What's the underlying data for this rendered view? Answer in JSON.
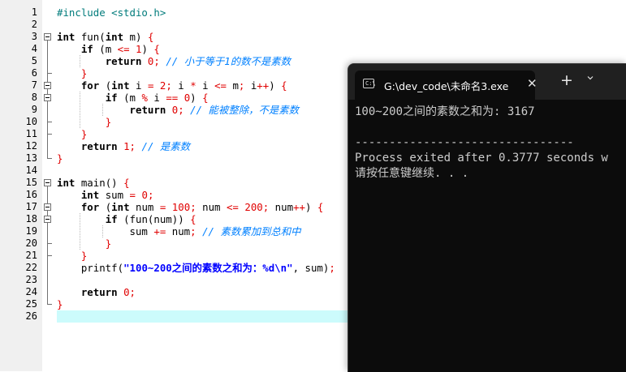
{
  "editor": {
    "current_line": 26,
    "lines": [
      {
        "n": "1",
        "tokens": [
          [
            "pp",
            "#include <stdio.h>"
          ]
        ]
      },
      {
        "n": "2",
        "tokens": []
      },
      {
        "n": "3",
        "tokens": [
          [
            "kw",
            "int"
          ],
          [
            "t",
            " fun("
          ],
          [
            "kw",
            "int"
          ],
          [
            "t",
            " m) "
          ],
          [
            "op",
            "{"
          ]
        ]
      },
      {
        "n": "4",
        "tokens": [
          [
            "t",
            "    "
          ],
          [
            "kw",
            "if"
          ],
          [
            "t",
            " ("
          ],
          [
            "t",
            "m "
          ],
          [
            "op",
            "<="
          ],
          [
            "t",
            " "
          ],
          [
            "num",
            "1"
          ],
          [
            "t",
            ") "
          ],
          [
            "op",
            "{"
          ]
        ]
      },
      {
        "n": "5",
        "tokens": [
          [
            "t",
            "        "
          ],
          [
            "kw",
            "return"
          ],
          [
            "t",
            " "
          ],
          [
            "num",
            "0"
          ],
          [
            "op",
            ";"
          ],
          [
            "t",
            " "
          ],
          [
            "cmt",
            "// 小于等于1的数不是素数"
          ]
        ]
      },
      {
        "n": "6",
        "tokens": [
          [
            "t",
            "    "
          ],
          [
            "op",
            "}"
          ]
        ]
      },
      {
        "n": "7",
        "tokens": [
          [
            "t",
            "    "
          ],
          [
            "kw",
            "for"
          ],
          [
            "t",
            " ("
          ],
          [
            "kw",
            "int"
          ],
          [
            "t",
            " i "
          ],
          [
            "op",
            "="
          ],
          [
            "t",
            " "
          ],
          [
            "num",
            "2"
          ],
          [
            "op",
            ";"
          ],
          [
            "t",
            " i "
          ],
          [
            "op",
            "*"
          ],
          [
            "t",
            " i "
          ],
          [
            "op",
            "<="
          ],
          [
            "t",
            " m"
          ],
          [
            "op",
            ";"
          ],
          [
            "t",
            " i"
          ],
          [
            "op",
            "++"
          ],
          [
            "t",
            ") "
          ],
          [
            "op",
            "{"
          ]
        ]
      },
      {
        "n": "8",
        "tokens": [
          [
            "t",
            "        "
          ],
          [
            "kw",
            "if"
          ],
          [
            "t",
            " (m "
          ],
          [
            "op",
            "%"
          ],
          [
            "t",
            " i "
          ],
          [
            "op",
            "=="
          ],
          [
            "t",
            " "
          ],
          [
            "num",
            "0"
          ],
          [
            "t",
            ") "
          ],
          [
            "op",
            "{"
          ]
        ]
      },
      {
        "n": "9",
        "tokens": [
          [
            "t",
            "            "
          ],
          [
            "kw",
            "return"
          ],
          [
            "t",
            " "
          ],
          [
            "num",
            "0"
          ],
          [
            "op",
            ";"
          ],
          [
            "t",
            " "
          ],
          [
            "cmt",
            "// 能被整除，不是素数"
          ]
        ]
      },
      {
        "n": "10",
        "tokens": [
          [
            "t",
            "        "
          ],
          [
            "op",
            "}"
          ]
        ]
      },
      {
        "n": "11",
        "tokens": [
          [
            "t",
            "    "
          ],
          [
            "op",
            "}"
          ]
        ]
      },
      {
        "n": "12",
        "tokens": [
          [
            "t",
            "    "
          ],
          [
            "kw",
            "return"
          ],
          [
            "t",
            " "
          ],
          [
            "num",
            "1"
          ],
          [
            "op",
            ";"
          ],
          [
            "t",
            " "
          ],
          [
            "cmt",
            "// 是素数"
          ]
        ]
      },
      {
        "n": "13",
        "tokens": [
          [
            "op",
            "}"
          ]
        ]
      },
      {
        "n": "14",
        "tokens": []
      },
      {
        "n": "15",
        "tokens": [
          [
            "kw",
            "int"
          ],
          [
            "t",
            " main() "
          ],
          [
            "op",
            "{"
          ]
        ]
      },
      {
        "n": "16",
        "tokens": [
          [
            "t",
            "    "
          ],
          [
            "kw",
            "int"
          ],
          [
            "t",
            " sum "
          ],
          [
            "op",
            "="
          ],
          [
            "t",
            " "
          ],
          [
            "num",
            "0"
          ],
          [
            "op",
            ";"
          ]
        ]
      },
      {
        "n": "17",
        "tokens": [
          [
            "t",
            "    "
          ],
          [
            "kw",
            "for"
          ],
          [
            "t",
            " ("
          ],
          [
            "kw",
            "int"
          ],
          [
            "t",
            " num "
          ],
          [
            "op",
            "="
          ],
          [
            "t",
            " "
          ],
          [
            "num",
            "100"
          ],
          [
            "op",
            ";"
          ],
          [
            "t",
            " num "
          ],
          [
            "op",
            "<="
          ],
          [
            "t",
            " "
          ],
          [
            "num",
            "200"
          ],
          [
            "op",
            ";"
          ],
          [
            "t",
            " num"
          ],
          [
            "op",
            "++"
          ],
          [
            "t",
            ") "
          ],
          [
            "op",
            "{"
          ]
        ]
      },
      {
        "n": "18",
        "tokens": [
          [
            "t",
            "        "
          ],
          [
            "kw",
            "if"
          ],
          [
            "t",
            " (fun(num)) "
          ],
          [
            "op",
            "{"
          ]
        ]
      },
      {
        "n": "19",
        "tokens": [
          [
            "t",
            "            sum "
          ],
          [
            "op",
            "+="
          ],
          [
            "t",
            " num"
          ],
          [
            "op",
            ";"
          ],
          [
            "t",
            " "
          ],
          [
            "cmt",
            "// 素数累加到总和中"
          ]
        ]
      },
      {
        "n": "20",
        "tokens": [
          [
            "t",
            "        "
          ],
          [
            "op",
            "}"
          ]
        ]
      },
      {
        "n": "21",
        "tokens": [
          [
            "t",
            "    "
          ],
          [
            "op",
            "}"
          ]
        ]
      },
      {
        "n": "22",
        "tokens": [
          [
            "t",
            "    printf("
          ],
          [
            "str",
            "\"100~200之间的素数之和为：%d\\n\""
          ],
          [
            "t",
            ", sum)"
          ],
          [
            "op",
            ";"
          ]
        ]
      },
      {
        "n": "23",
        "tokens": []
      },
      {
        "n": "24",
        "tokens": [
          [
            "t",
            "    "
          ],
          [
            "kw",
            "return"
          ],
          [
            "t",
            " "
          ],
          [
            "num",
            "0"
          ],
          [
            "op",
            ";"
          ]
        ]
      },
      {
        "n": "25",
        "tokens": [
          [
            "op",
            "}"
          ]
        ]
      },
      {
        "n": "26",
        "tokens": []
      }
    ]
  },
  "terminal": {
    "tab_icon_label": "C:\\",
    "tab_title": "G:\\dev_code\\未命名3.exe",
    "close_glyph": "✕",
    "new_tab_glyph": "+",
    "dropdown_icon": "chevron-down-icon",
    "output": [
      "100~200之间的素数之和为: 3167",
      "",
      "--------------------------------",
      "Process exited after 0.3777 seconds w",
      "请按任意键继续. . ."
    ],
    "colors": {
      "background": "#0c0c0c",
      "text": "#cccccc",
      "tabbar": "#202020"
    }
  },
  "colors": {
    "keyword": "#000000",
    "number": "#e00000",
    "comment": "#0080ff",
    "string": "#0000ff",
    "preprocessor": "#007b7b",
    "current_line": "#ccfbfc"
  }
}
